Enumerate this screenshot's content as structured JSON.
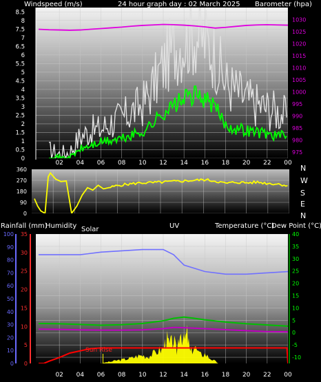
{
  "header": {
    "title": "24 hour graph day : 02 March 2025",
    "left_label": "Windspeed (m/s)",
    "right_label": "Barometer (hpa)"
  },
  "direction_labels": [
    "N",
    "W",
    "S",
    "E",
    "N"
  ],
  "lower_header": {
    "rain": "Rainfall (mm)",
    "humidity": "Humidity",
    "solar": "Solar",
    "uv": "UV",
    "temperature": "Temperature (°C)",
    "dew": "Dew Point (°C)"
  },
  "annotation": {
    "sun_rise": "Sun Rise"
  },
  "x_ticks": [
    "02",
    "04",
    "06",
    "08",
    "10",
    "12",
    "14",
    "16",
    "18",
    "20",
    "22",
    "00"
  ],
  "colors": {
    "wind_gust": "#e0e0e0",
    "wind_avg": "#00ff00",
    "barometer": "#e000e0",
    "direction": "#ffff00",
    "humidity": "#7070ff",
    "temperature": "#00c000",
    "dew_point": "#c000c0",
    "rain": "#ff0000",
    "solar": "#ffff00",
    "rain_axis": "#ff3030",
    "humidity_axis": "#6b6bff",
    "temp_axis": "#00ff00"
  },
  "chart_data": [
    {
      "type": "line",
      "ylabel": "Windspeed (m/s)",
      "y2label": "Barometer (hpa)",
      "ylim": [
        0,
        8.75
      ],
      "y_ticks": [
        0,
        0.5,
        1,
        1.5,
        2,
        2.5,
        3,
        3.5,
        4,
        4.5,
        5,
        5.5,
        6,
        6.5,
        7,
        7.5,
        8,
        8.5
      ],
      "y2lim": [
        972.5,
        1035
      ],
      "y2_ticks": [
        975,
        980,
        985,
        990,
        995,
        1000,
        1005,
        1010,
        1015,
        1020,
        1025,
        1030
      ],
      "series": [
        {
          "axis": "left",
          "x": [
            1,
            2,
            3,
            4,
            5,
            6,
            7,
            8,
            9,
            10,
            11,
            12,
            13,
            14,
            15,
            16,
            17,
            18,
            19,
            20,
            21,
            22,
            23,
            24
          ],
          "values": [
            0.4,
            0.2,
            0.3,
            1.2,
            1.5,
            1.6,
            2.0,
            2.2,
            2.6,
            3.0,
            4.0,
            5.2,
            6.2,
            6.6,
            7.0,
            6.6,
            5.8,
            4.2,
            3.8,
            3.3,
            3.0,
            2.8,
            2.6,
            2.3
          ]
        },
        {
          "axis": "left",
          "x": [
            1,
            2,
            3,
            4,
            5,
            6,
            7,
            8,
            9,
            10,
            11,
            12,
            13,
            14,
            15,
            16,
            17,
            18,
            19,
            20,
            21,
            22,
            23,
            24
          ],
          "values": [
            0.1,
            0.0,
            0.0,
            0.5,
            0.7,
            0.9,
            1.0,
            1.1,
            1.3,
            1.5,
            2.0,
            2.6,
            3.0,
            3.4,
            3.6,
            3.4,
            2.9,
            1.9,
            1.7,
            1.6,
            1.5,
            1.4,
            1.3,
            1.2
          ]
        },
        {
          "axis": "right",
          "x": [
            0,
            1,
            2,
            3,
            4,
            5,
            6,
            7,
            8,
            9,
            10,
            11,
            12,
            13,
            14,
            15,
            16,
            17,
            18,
            19,
            20,
            21,
            22,
            23,
            24
          ],
          "values": [
            1026,
            1025.8,
            1025.7,
            1025.6,
            1025.7,
            1026,
            1026.3,
            1026.6,
            1026.9,
            1027.3,
            1027.6,
            1027.8,
            1028,
            1027.9,
            1027.7,
            1027.4,
            1027,
            1026.5,
            1026.8,
            1027.2,
            1027.6,
            1027.8,
            1027.9,
            1027.8,
            1027.7
          ]
        }
      ]
    },
    {
      "type": "line",
      "ylim": [
        0,
        360
      ],
      "y_ticks": [
        0,
        90,
        180,
        270,
        360
      ],
      "series": [
        {
          "x": [
            0,
            0.3,
            0.6,
            1.0,
            1.3,
            1.5,
            2.0,
            2.5,
            3.0,
            3.5,
            4.0,
            4.5,
            5.0,
            5.5,
            6.0,
            6.5,
            7.0,
            8,
            9,
            10,
            11,
            12,
            13,
            14,
            15,
            16,
            17,
            18,
            19,
            20,
            21,
            22,
            23,
            24
          ],
          "values": [
            120,
            60,
            20,
            0,
            300,
            330,
            280,
            260,
            265,
            0,
            60,
            150,
            210,
            190,
            230,
            200,
            210,
            230,
            240,
            250,
            250,
            255,
            260,
            265,
            270,
            275,
            265,
            245,
            255,
            250,
            255,
            245,
            240,
            225
          ]
        }
      ]
    },
    {
      "type": "line",
      "ylabel": "Rainfall (mm)",
      "y_ticks": [
        0,
        5,
        10,
        15,
        20,
        25,
        30,
        35
      ],
      "ylim": [
        0,
        35
      ],
      "y_humidity_ticks": [
        0,
        10,
        20,
        30,
        40,
        50,
        60,
        70,
        80,
        90,
        100
      ],
      "y_humidity_lim": [
        0,
        100
      ],
      "y2label": "Temperature (°C)",
      "y2_ticks": [
        -10,
        -5,
        0,
        5,
        10,
        15,
        20,
        25,
        30,
        35,
        40
      ],
      "y2lim": [
        -12.5,
        40
      ],
      "series": [
        {
          "name": "Humidity",
          "x": [
            0,
            2,
            4,
            6,
            8,
            10,
            12,
            13,
            14,
            16,
            18,
            20,
            22,
            24
          ],
          "values": [
            84,
            84,
            84,
            86,
            87,
            88,
            88,
            84,
            76,
            71,
            69,
            69,
            70,
            71
          ]
        },
        {
          "name": "Temperature (°C)",
          "x": [
            0,
            2,
            4,
            6,
            8,
            10,
            12,
            13,
            14,
            15,
            16,
            18,
            20,
            22,
            24
          ],
          "values": [
            3.7,
            3.6,
            3.3,
            3.0,
            3.2,
            3.7,
            4.8,
            5.8,
            6.3,
            5.8,
            5.2,
            4.3,
            3.6,
            3.1,
            2.6
          ]
        },
        {
          "name": "Dew Point (°C)",
          "x": [
            0,
            2,
            4,
            6,
            8,
            10,
            12,
            13,
            14,
            16,
            18,
            20,
            22,
            24
          ],
          "values": [
            1.4,
            1.3,
            1.1,
            1.0,
            1.0,
            1.1,
            1.6,
            2.1,
            2.0,
            1.6,
            1.2,
            0.8,
            0.4,
            0.3
          ]
        },
        {
          "name": "Rainfall (mm)",
          "x": [
            0,
            0.5,
            1,
            2,
            3,
            4,
            5,
            6,
            7,
            8,
            10,
            12,
            14,
            16,
            18,
            20,
            22,
            23.9,
            24
          ],
          "values": [
            0,
            0,
            0.6,
            1.6,
            2.8,
            3.4,
            4.0,
            4.2,
            4.2,
            4.2,
            4.2,
            4.2,
            4.2,
            4.2,
            4.2,
            4.2,
            4.2,
            4.2,
            0
          ]
        },
        {
          "name": "Solar",
          "x": [
            6,
            6.5,
            7,
            7.5,
            8,
            8.5,
            9,
            9.5,
            10,
            10.5,
            11,
            11.5,
            12,
            12.3,
            12.6,
            13,
            13.3,
            13.6,
            14,
            14.3,
            14.6,
            15,
            15.5,
            16,
            16.5,
            17,
            17.3
          ],
          "values": [
            0,
            0.3,
            0.5,
            0.8,
            1.0,
            1.2,
            1.5,
            2.0,
            2.2,
            1.8,
            2.6,
            3.4,
            4.0,
            7.0,
            5.0,
            6.4,
            3.2,
            9.6,
            6.0,
            8.0,
            3.0,
            4.6,
            2.4,
            2.6,
            1.4,
            0.6,
            0
          ]
        }
      ],
      "annotations": [
        {
          "text": "Sun Rise",
          "x": 6.2
        }
      ]
    }
  ]
}
